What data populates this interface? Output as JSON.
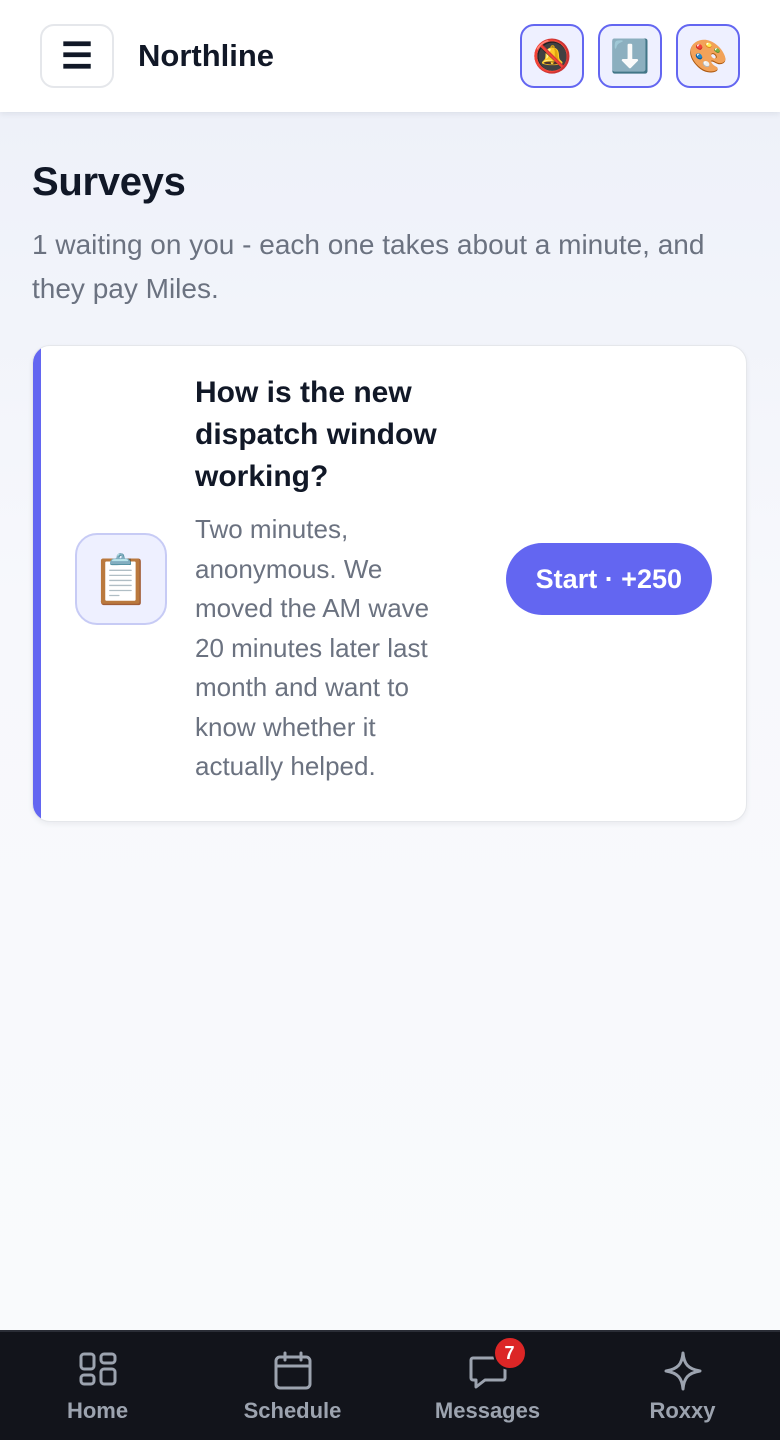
{
  "header": {
    "menu_icon": "☰",
    "brand": "Northline",
    "actions": [
      {
        "name": "notifications-muted-icon",
        "glyph": "🔕"
      },
      {
        "name": "download-icon",
        "glyph": "⬇️"
      },
      {
        "name": "palette-icon",
        "glyph": "🎨"
      }
    ]
  },
  "page": {
    "title": "Surveys",
    "subtitle": "1 waiting on you - each one takes about a minute, and they pay Miles."
  },
  "survey": {
    "icon": "📋",
    "title": "How is the new dispatch window working?",
    "description": "Two minutes, anonymous. We moved the AM wave 20 minutes later last month and want to know whether it actually helped.",
    "button_label": "Start · +250"
  },
  "nav": {
    "items": [
      {
        "label": "Home",
        "icon": "grid-icon"
      },
      {
        "label": "Schedule",
        "icon": "calendar-icon"
      },
      {
        "label": "Messages",
        "icon": "chat-icon",
        "badge": "7"
      },
      {
        "label": "Roxxy",
        "icon": "sparkle-icon"
      }
    ]
  },
  "colors": {
    "accent": "#6366f1",
    "badge": "#dc2626",
    "nav_bg": "#12141b"
  }
}
